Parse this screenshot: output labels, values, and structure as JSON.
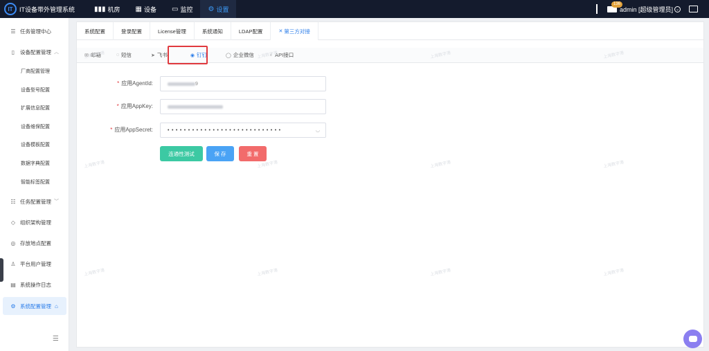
{
  "app": {
    "title": "IT设备带外管理系统",
    "logo_text": "IT"
  },
  "topnav": [
    {
      "label": "机房",
      "icon": "bar-chart-icon"
    },
    {
      "label": "设备",
      "icon": "grid-icon"
    },
    {
      "label": "监控",
      "icon": "monitor-icon"
    },
    {
      "label": "设置",
      "icon": "gear-icon",
      "active": true
    }
  ],
  "header": {
    "mail_count": "136",
    "user": "admin [超级管理员]"
  },
  "sidebar": {
    "items": [
      {
        "label": "任务管理中心"
      },
      {
        "label": "设备配置管理"
      },
      {
        "label": "厂商配置管理"
      },
      {
        "label": "设备型号配置"
      },
      {
        "label": "扩展信息配置"
      },
      {
        "label": "设备维保配置"
      },
      {
        "label": "设备模板配置"
      },
      {
        "label": "数据字典配置"
      },
      {
        "label": "智能标签配置"
      },
      {
        "label": "任务配置管理"
      },
      {
        "label": "组织架构管理"
      },
      {
        "label": "存放地点配置"
      },
      {
        "label": "平台用户管理"
      },
      {
        "label": "系统操作日志"
      },
      {
        "label": "系统配置管理"
      }
    ]
  },
  "tabs_primary": [
    "系统配置",
    "登录配置",
    "License管理",
    "系统通知",
    "LDAP配置",
    "第三方对接"
  ],
  "tabs_secondary": [
    "邮箱",
    "短信",
    "飞书",
    "钉钉",
    "企业微信",
    "API接口"
  ],
  "form": {
    "agentid_label": "应用AgentId:",
    "agentid_value_tail": "9",
    "appkey_label": "应用AppKey:",
    "appsecret_label": "应用AppSecret:",
    "appsecret_mask": "••••••••••••••••••••••••••••"
  },
  "buttons": {
    "test": "连通性测试",
    "save": "保 存",
    "reset": "重 置"
  },
  "watermark": "上海数字港",
  "colors": {
    "accent": "#2b7de9",
    "topbar": "#141b2d",
    "test": "#3cc9a3",
    "save": "#4aa3f5",
    "reset": "#f26b6b",
    "highlight": "#e0393e"
  }
}
